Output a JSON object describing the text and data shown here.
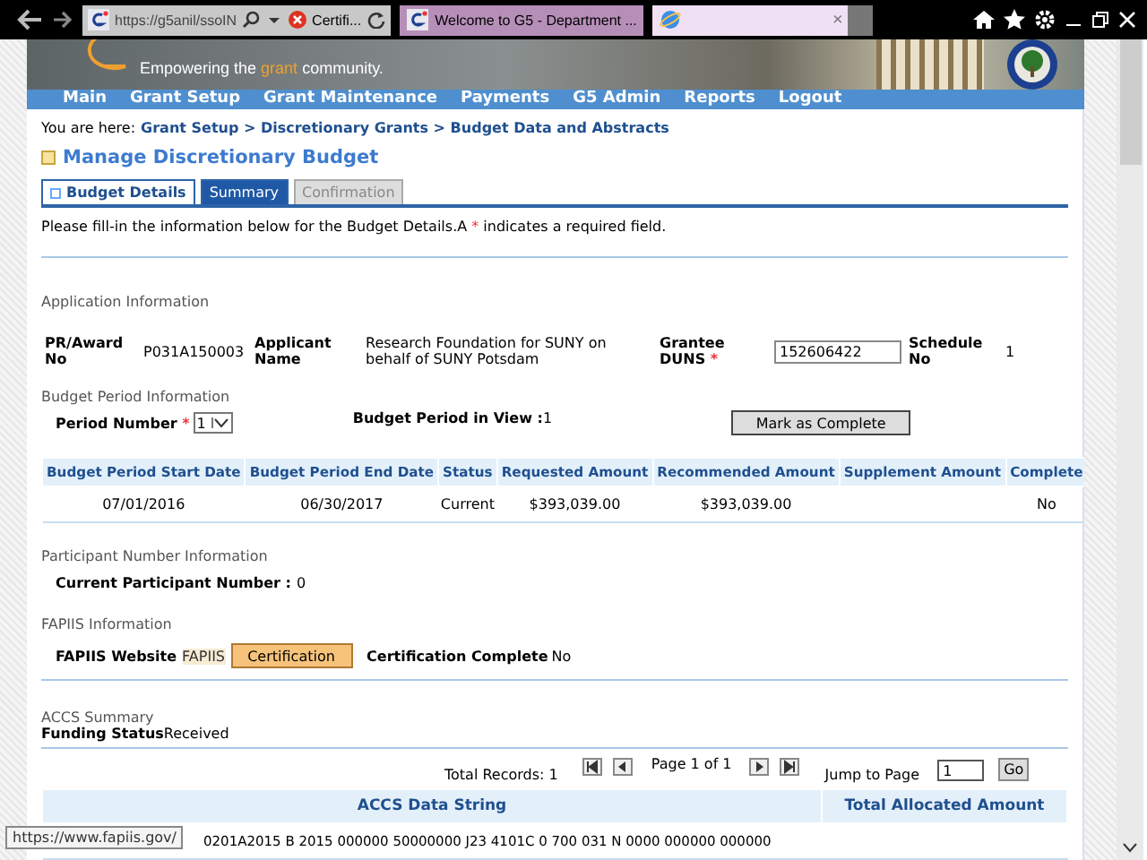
{
  "browser": {
    "address": "https://g5anil/ssoIN",
    "certificate": "Certifi...",
    "tabs": [
      {
        "title": "Welcome to G5 - Department ...",
        "selected": false
      },
      {
        "close": "×",
        "selected": true
      }
    ]
  },
  "banner": {
    "tagline_start": "Empowering the ",
    "tagline_highlight": "grant",
    "tagline_end": " community."
  },
  "nav": [
    "Main",
    "Grant Setup",
    "Grant Maintenance",
    "Payments",
    "G5 Admin",
    "Reports",
    "Logout"
  ],
  "breadcrumb": {
    "label": "You are here:",
    "path": "Grant Setup > Discretionary Grants > Budget Data and Abstracts"
  },
  "page_title": "Manage Discretionary Budget",
  "tabs": [
    {
      "label": "Budget Details",
      "selected": true,
      "disabled": false
    },
    {
      "label": "Summary",
      "selected": false,
      "disabled": false
    },
    {
      "label": "Confirmation",
      "selected": false,
      "disabled": true
    }
  ],
  "instructions": {
    "before": "Please fill-in the information below for the Budget Details.A ",
    "required_mark": "*",
    "after": " indicates a required field."
  },
  "application": {
    "heading": "Application Information",
    "award_label": "PR/Award No",
    "award": "P031A150003",
    "applicant_label": "Applicant Name",
    "applicant": "Research Foundation for SUNY on behalf of SUNY Potsdam",
    "duns_label": "Grantee DUNS",
    "duns_required": "*",
    "duns": "152606422",
    "schedule_label": "Schedule No",
    "schedule": "1"
  },
  "period": {
    "heading": "Budget Period Information",
    "number_label": "Period Number",
    "number_required": "*",
    "number": "1",
    "in_view_label": "Budget Period in View :",
    "in_view": "1",
    "button": "Mark as Complete"
  },
  "period_table": {
    "columns": [
      "Budget Period Start Date",
      "Budget Period End Date",
      "Status",
      "Requested Amount",
      "Recommended Amount",
      "Supplement Amount",
      "Complete"
    ],
    "rows": [
      [
        "07/01/2016",
        "06/30/2017",
        "Current",
        "$393,039.00",
        "$393,039.00",
        "",
        "No"
      ]
    ]
  },
  "participant": {
    "heading": "Participant Number Information",
    "label": "Current Participant Number :",
    "value": "0"
  },
  "fapiis": {
    "heading": "FAPIIS Information",
    "website_label": "FAPIIS Website",
    "link": "FAPIIS",
    "button": "Certification",
    "complete_label": "Certification Complete",
    "complete": "No"
  },
  "accs": {
    "heading": "ACCS Summary",
    "status_label": "Funding Status",
    "status": "Received",
    "total_records": "Total Records: 1",
    "page": "Page 1 of 1",
    "jump_label": "Jump to Page",
    "jump": "1",
    "go": "Go",
    "columns": [
      "ACCS Data String",
      "Total Allocated Amount"
    ],
    "rows": [
      [
        "0201A2015 B 2015 000000 50000000 J23 4101C 0 700 031 N 0000 000000 000000",
        ""
      ]
    ]
  },
  "status_tooltip": "https://www.fapiis.gov/"
}
